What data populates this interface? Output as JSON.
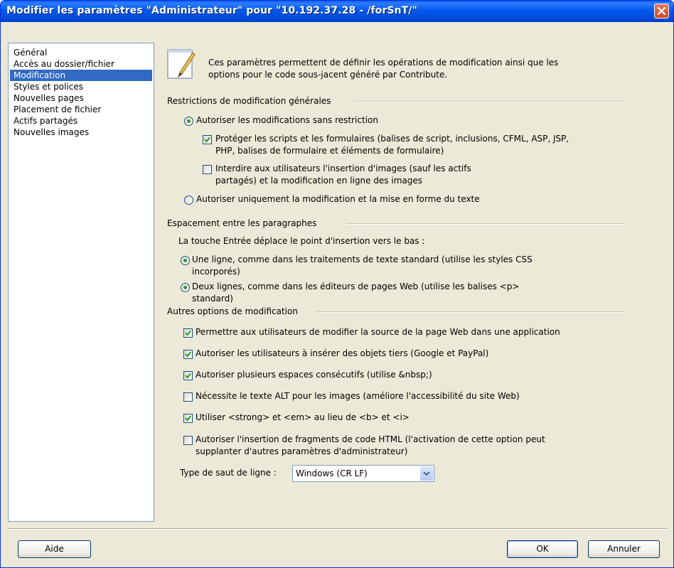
{
  "window": {
    "title": "Modifier les paramètres \"Administrateur\" pour \"10.192.37.28 - /forSnT/\""
  },
  "sidebar": {
    "items": [
      {
        "label": "Général"
      },
      {
        "label": "Accès au dossier/fichier"
      },
      {
        "label": "Modification",
        "selected": true
      },
      {
        "label": "Styles et polices"
      },
      {
        "label": "Nouvelles pages"
      },
      {
        "label": "Placement de fichier"
      },
      {
        "label": "Actifs partagés"
      },
      {
        "label": "Nouvelles images"
      }
    ]
  },
  "header": {
    "icon": "notepad-pencil-icon",
    "description_1": "Ces paramètres permettent de définir les opérations de modification ainsi que les",
    "description_2": "options pour le code sous-jacent généré par Contribute."
  },
  "restrictions": {
    "title": "Restrictions de modification générales",
    "option_unrestricted": "Autoriser les modifications sans restriction",
    "protect_scripts_1": "Protéger les scripts et les formulaires (balises de script, inclusions, CFML, ASP, JSP,",
    "protect_scripts_2": "PHP, balises de formulaire et éléments de formulaire)",
    "protect_scripts_checked": true,
    "forbid_images_1": "Interdire aux utilisateurs l'insertion d'images (sauf les actifs",
    "forbid_images_2": "partagés) et la modification en ligne des images",
    "forbid_images_checked": false,
    "option_text_only": "Autoriser uniquement la modification et la mise en forme du texte",
    "selected": "unrestricted"
  },
  "spacing": {
    "title": "Espacement entre les paragraphes",
    "prompt": "La touche Entrée déplace le point d'insertion vers le bas :",
    "one_line_1": "Une ligne, comme dans les traitements de texte standard (utilise les styles CSS",
    "one_line_2": "incorporés)",
    "two_lines_1": "Deux lignes, comme dans les éditeurs de pages Web (utilise les balises <p>",
    "two_lines_2": "standard)"
  },
  "other": {
    "title": "Autres options de modification",
    "opt1": "Permettre aux utilisateurs de modifier la source de la page Web dans une application",
    "opt1_checked": true,
    "opt2": "Autoriser les utilisateurs à insérer des objets tiers (Google et PayPal)",
    "opt2_checked": true,
    "opt3": "Autoriser plusieurs espaces consécutifs (utilise &nbsp;)",
    "opt3_checked": true,
    "opt4": "Nécessite le texte ALT pour les images (améliore l'accessibilité du site Web)",
    "opt4_checked": false,
    "opt5": "Utiliser <strong> et <em> au lieu de <b> et <i>",
    "opt5_checked": true,
    "opt6_1": "Autoriser l'insertion de fragments de code HTML (l'activation de cette option peut",
    "opt6_2": "supplanter d'autres paramètres d'administrateur)",
    "opt6_checked": false,
    "linebreak_label": "Type de saut de ligne :",
    "linebreak_value": "Windows (CR LF)"
  },
  "buttons": {
    "help": "Aide",
    "ok": "OK",
    "cancel": "Annuler"
  },
  "colors": {
    "titlebar": "#0058ee",
    "selection": "#316ac5",
    "window_bg": "#ece9d8",
    "close_button": "#d2461f",
    "check_mark": "#21a121"
  }
}
